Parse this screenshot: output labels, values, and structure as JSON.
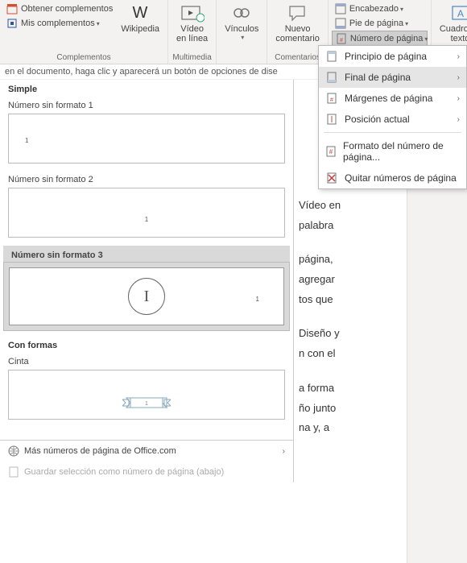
{
  "ribbon": {
    "addins": {
      "get": "Obtener complementos",
      "my": "Mis complementos",
      "wikipedia": "Wikipedia",
      "group": "Complementos"
    },
    "media": {
      "video": "Vídeo\nen línea",
      "group": "Multimedia"
    },
    "links": {
      "links": "Vínculos",
      "group": ""
    },
    "comments": {
      "new": "Nuevo\ncomentario",
      "group": "Comentarios"
    },
    "headerfooter": {
      "header": "Encabezado",
      "footer": "Pie de página",
      "pagenum": "Número de página"
    },
    "text": {
      "textbox": "Cuadro de\ntexto"
    }
  },
  "doc_strip": "en el documento, haga clic y aparecerá un botón de opciones de dise",
  "gallery": {
    "simple": "Simple",
    "opt1": "Número sin formato 1",
    "opt2": "Número sin formato 2",
    "opt3": "Número sin formato 3",
    "shapes": "Con formas",
    "cinta": "Cinta",
    "more": "Más números de página de Office.com",
    "save": "Guardar selección como número de página (abajo)"
  },
  "doc_frags": {
    "a": "Vídeo en",
    "b": "palabra",
    "c": "página,",
    "d": "agregar",
    "e": "tos que",
    "f": "Diseño y",
    "g": "n con el",
    "h": "a forma",
    "i": "ño junto",
    "j": "na y, a"
  },
  "submenu": {
    "top": "Principio de página",
    "bottom": "Final de página",
    "margins": "Márgenes de página",
    "current": "Posición actual",
    "format": "Formato del número de página...",
    "remove": "Quitar números de página"
  }
}
